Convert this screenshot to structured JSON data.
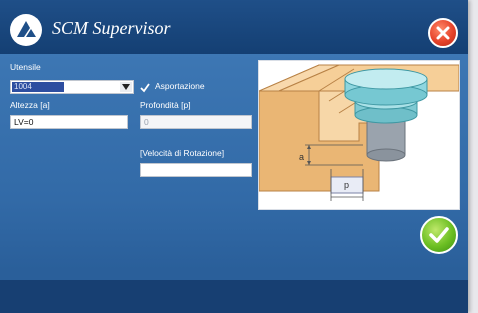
{
  "window": {
    "title": "SCM Supervisor",
    "accent_color": "#3c76b3",
    "close_icon": "close-icon",
    "ok_icon": "checkmark-icon"
  },
  "form": {
    "tool_label": "Utensile",
    "tool_value": "1004",
    "removal_label": "Asportazione",
    "removal_checked": true,
    "height_label": "Altezza [a]",
    "height_value": "LV=0",
    "depth_label": "Profondità [p]",
    "depth_value": "0",
    "speed_label": "[Velocità di Rotazione]",
    "speed_value": ""
  },
  "illustration": {
    "label_a": "a",
    "label_p": "p"
  }
}
